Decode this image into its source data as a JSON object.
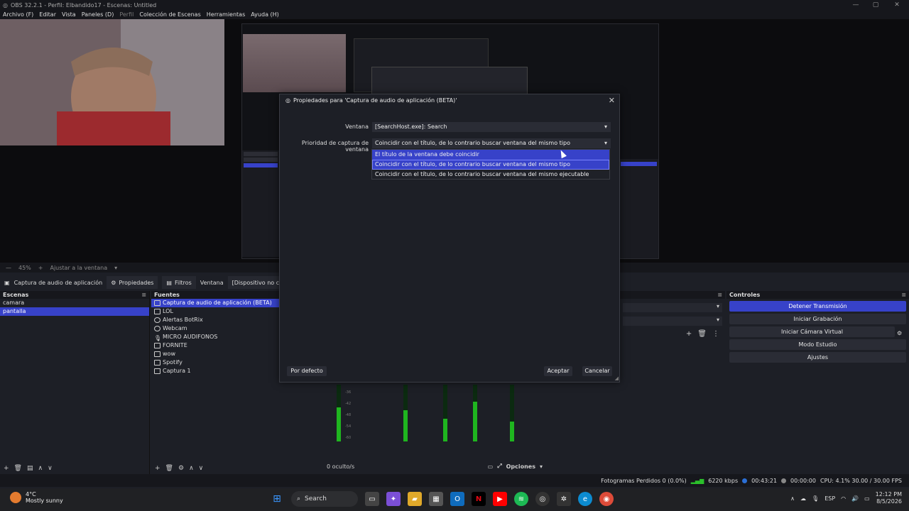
{
  "window": {
    "title": "OBS 32.2.1 - Perfil: Elbandido17 - Escenas: Untitled"
  },
  "menu": [
    "Archivo (F)",
    "Editar",
    "Vista",
    "Paneles (D)",
    "Perfil",
    "Colección de Escenas",
    "Herramientas",
    "Ayuda (H)"
  ],
  "status_row": {
    "zoom": "45%",
    "fit": "Ajustar a la ventana"
  },
  "source_toolbar": {
    "source_name": "Captura de audio de aplicación",
    "properties": "Propiedades",
    "filters": "Filtros",
    "window_label": "Ventana",
    "window_value": "[Dispositivo no conec"
  },
  "scenes": {
    "header": "Escenas",
    "items": [
      "camara",
      "pantalla"
    ],
    "selected": "pantalla"
  },
  "sources": {
    "header": "Fuentes",
    "items": [
      "Captura de audio de aplicación (BETA)",
      "LOL",
      "Alertas BotRix",
      "Webcam",
      "MICRO AUDIFONOS",
      "FORNITE",
      "wow",
      "Spotify",
      "Captura 1"
    ]
  },
  "mixer": {
    "hidden_label": "0 oculto/s",
    "options_label": "Opciones",
    "ticks": [
      "-36",
      "-42",
      "-48",
      "-54",
      "-60"
    ]
  },
  "controls": {
    "header": "Controles",
    "buttons": [
      "Detener Transmisión",
      "Iniciar Grabación",
      "Iniciar Cámara Virtual",
      "Modo Estudio",
      "Ajustes"
    ]
  },
  "statusbar": {
    "dropped": "Fotogramas Perdidos 0 (0.0%)",
    "bitrate": "6220 kbps",
    "stream_time": "00:43:21",
    "rec_time": "00:00:00",
    "cpu": "CPU: 4.1%  30.00 / 30.00 FPS"
  },
  "dialog": {
    "title": "Propiedades para 'Captura de audio de aplicación (BETA)'",
    "window_label": "Ventana",
    "window_value": "[SearchHost.exe]: Search",
    "priority_label": "Prioridad de captura de ventana",
    "priority_value": "Coincidir con el título, de lo contrario buscar ventana del mismo tipo",
    "options": [
      "El título de la ventana debe coincidir",
      "Coincidir con el título, de lo contrario buscar ventana del mismo tipo",
      "Coincidir con el título, de lo contrario buscar ventana del mismo ejecutable"
    ],
    "defaults_button": "Por defecto",
    "ok_button": "Aceptar",
    "cancel_button": "Cancelar"
  },
  "taskbar": {
    "temperature": "4°C",
    "condition": "Mostly sunny",
    "search": "Search",
    "lang": "ESP",
    "time": "12:12 PM",
    "date": "8/5/2026"
  },
  "colors": {
    "accent": "#3742c9",
    "meter": "#1fb51f"
  }
}
